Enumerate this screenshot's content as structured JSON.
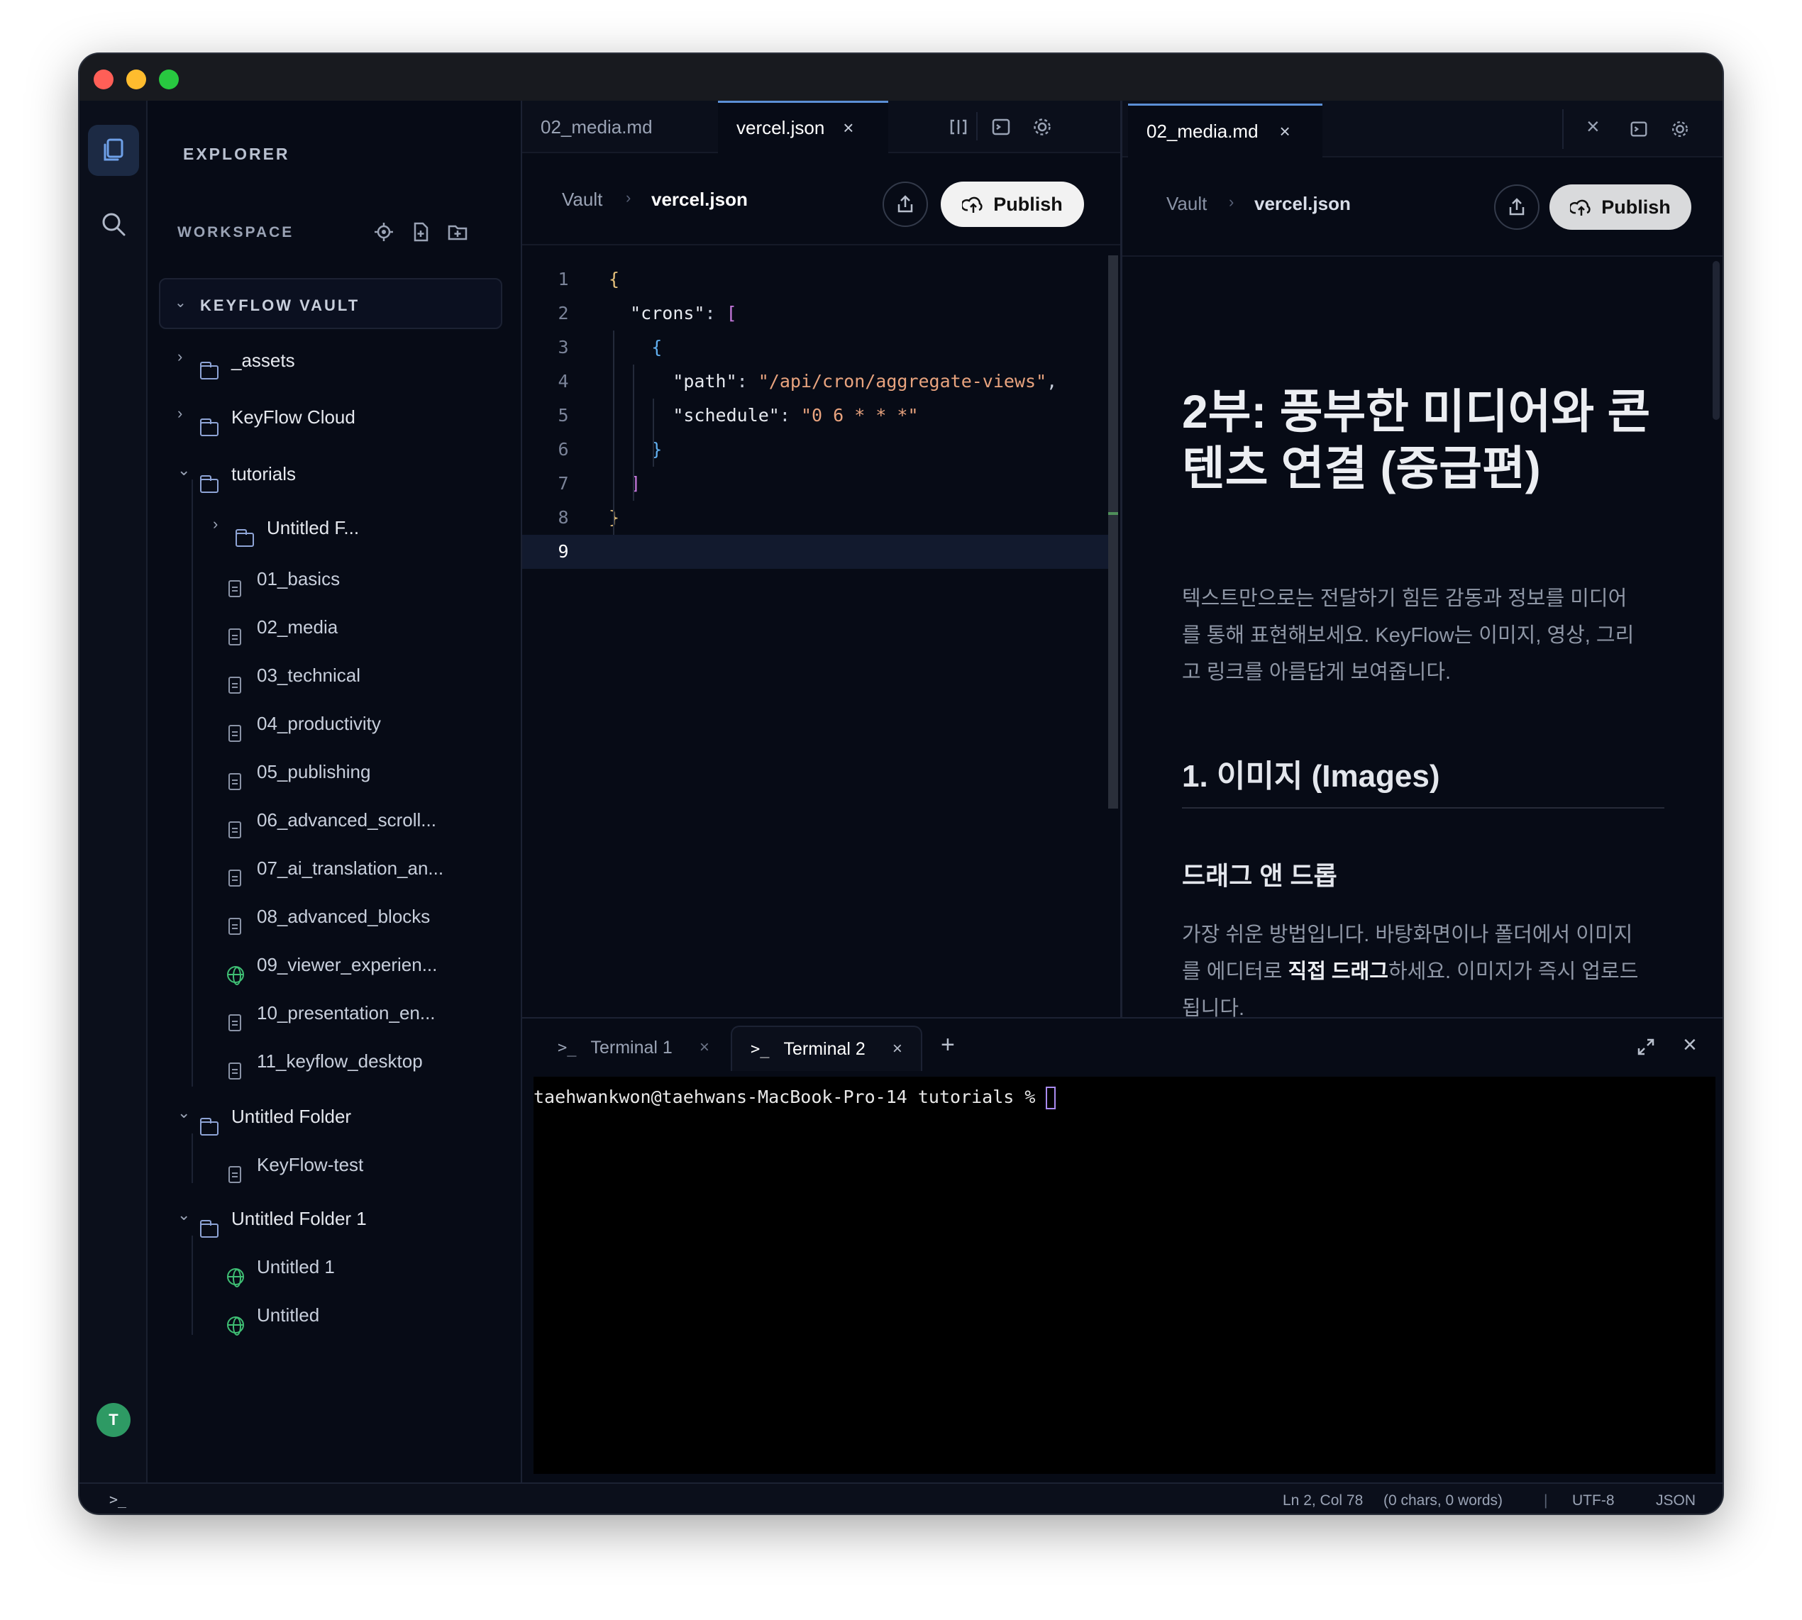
{
  "explorer": {
    "title": "EXPLORER",
    "workspace_label": "WORKSPACE",
    "vault_name": "KEYFLOW VAULT",
    "tree": [
      {
        "label": "_assets",
        "type": "folder",
        "expanded": false,
        "indent": 0
      },
      {
        "label": "KeyFlow Cloud",
        "type": "folder",
        "expanded": false,
        "indent": 0
      },
      {
        "label": "tutorials",
        "type": "folder",
        "expanded": true,
        "indent": 0
      },
      {
        "label": "Untitled F...",
        "type": "folder",
        "expanded": false,
        "indent": 1
      },
      {
        "label": "01_basics",
        "type": "file",
        "indent": 1
      },
      {
        "label": "02_media",
        "type": "file",
        "indent": 1
      },
      {
        "label": "03_technical",
        "type": "file",
        "indent": 1
      },
      {
        "label": "04_productivity",
        "type": "file",
        "indent": 1
      },
      {
        "label": "05_publishing",
        "type": "file",
        "indent": 1
      },
      {
        "label": "06_advanced_scroll...",
        "type": "file",
        "indent": 1
      },
      {
        "label": "07_ai_translation_an...",
        "type": "file",
        "indent": 1
      },
      {
        "label": "08_advanced_blocks",
        "type": "file",
        "indent": 1
      },
      {
        "label": "09_viewer_experien...",
        "type": "web",
        "indent": 1
      },
      {
        "label": "10_presentation_en...",
        "type": "file",
        "indent": 1
      },
      {
        "label": "11_keyflow_desktop",
        "type": "file",
        "indent": 1
      },
      {
        "label": "Untitled Folder",
        "type": "folder",
        "expanded": true,
        "indent": 0
      },
      {
        "label": "KeyFlow-test",
        "type": "file",
        "indent": 1
      },
      {
        "label": "Untitled Folder 1",
        "type": "folder",
        "expanded": true,
        "indent": 0
      },
      {
        "label": "Untitled 1",
        "type": "web",
        "indent": 1
      },
      {
        "label": "Untitled",
        "type": "web",
        "indent": 1
      }
    ]
  },
  "avatar_letter": "T",
  "left_pane": {
    "tabs": [
      "02_media.md",
      "vercel.json"
    ],
    "breadcrumb_root": "Vault",
    "breadcrumb_file": "vercel.json",
    "publish_label": "Publish",
    "code_lines": [
      "{",
      "  \"crons\": [",
      "    {",
      "      \"path\": \"/api/cron/aggregate-views\",",
      "      \"schedule\": \"0 6 * * *\"",
      "    }",
      "  ]",
      "}",
      ""
    ],
    "line_numbers": [
      "1",
      "2",
      "3",
      "4",
      "5",
      "6",
      "7",
      "8",
      "9"
    ]
  },
  "right_pane": {
    "tab": "02_media.md",
    "breadcrumb_root": "Vault",
    "breadcrumb_file": "vercel.json",
    "publish_label": "Publish",
    "h1_line1": "2부: 풍부한 미디어와 콘",
    "h1_line2": "텐츠 연결 (중급편)",
    "intro_line1": "텍스트만으로는 전달하기 힘든 감동과 정보를 미디어",
    "intro_line2": "를 통해 표현해보세요. KeyFlow는 이미지, 영상, 그리",
    "intro_line3": "고 링크를 아름답게 보여줍니다.",
    "h2": "1. 이미지 (Images)",
    "h3": "드래그 앤 드롭",
    "body_line1": "가장 쉬운 방법입니다. 바탕화면이나 폴더에서 이미지",
    "body_line2_pre": "를 에디터로 ",
    "body_line2_bold": "직접 드래그",
    "body_line2_post": "하세요. 이미지가 즉시 업로드",
    "body_line3": "됩니다."
  },
  "terminal": {
    "tabs": [
      "Terminal 1",
      "Terminal 2"
    ],
    "prompt": "taehwankwon@taehwans-MacBook-Pro-14 tutorials % "
  },
  "status": {
    "position": "Ln 2, Col 78",
    "counts": "(0 chars, 0 words)",
    "separator": "|",
    "encoding": "UTF-8",
    "language": "JSON"
  },
  "colors": {
    "accent": "#5b8fd6",
    "web_icon": "#3fbf74",
    "avatar_bg": "#2e9a64"
  }
}
